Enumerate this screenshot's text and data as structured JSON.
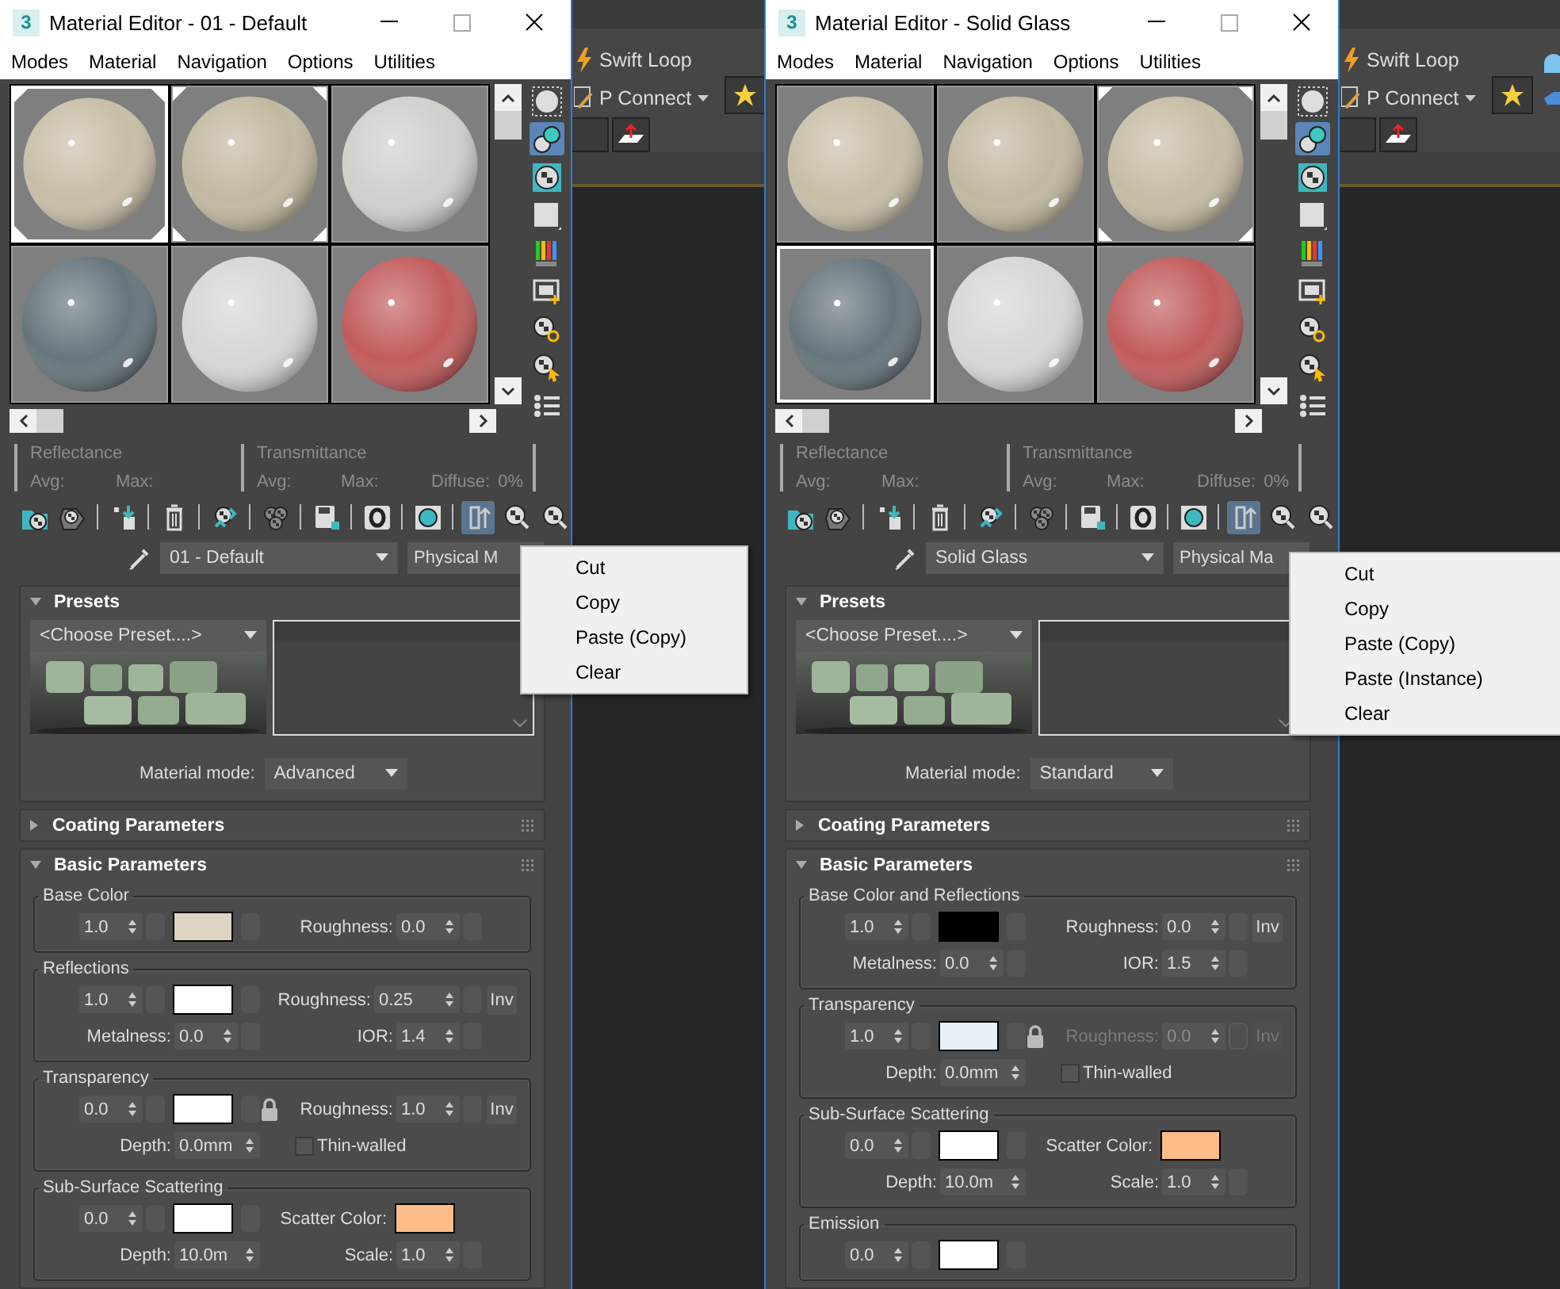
{
  "backdrop": {
    "ribbons": [
      {
        "tools": [
          "Swift Loop",
          "P Connect"
        ]
      },
      {
        "tools": [
          "Swift Loop",
          "P Connect"
        ]
      }
    ]
  },
  "windows": [
    {
      "title": "Material Editor - 01 - Default",
      "app_icon": "3",
      "menus": [
        "Modes",
        "Material",
        "Navigation",
        "Options",
        "Utilities"
      ],
      "slots": [
        {
          "color": "#c8bea6",
          "selected": true,
          "hot": true
        },
        {
          "color": "#c2b89f",
          "selected": false,
          "hot": true
        },
        {
          "color": "#cfcfcc",
          "selected": false,
          "hot": false
        },
        {
          "color": "#66757c",
          "selected": false,
          "hot": false
        },
        {
          "color": "#d6d6d6",
          "selected": false,
          "hot": false
        },
        {
          "color": "#c25b5b",
          "selected": false,
          "hot": false
        }
      ],
      "side_tools": [
        {
          "selected": false
        },
        {
          "selected": true
        },
        {
          "selected": false
        },
        {
          "selected": false
        },
        {
          "selected": false
        },
        {
          "selected": false
        },
        {
          "selected": false
        },
        {
          "selected": false
        },
        {
          "selected": false
        }
      ],
      "reflectance": {
        "title": "Reflectance",
        "avg": "Avg:",
        "max": "Max:"
      },
      "transmittance": {
        "title": "Transmittance",
        "avg": "Avg:",
        "max": "Max:",
        "diffuse": "Diffuse:",
        "diffuse_value": "0%"
      },
      "toolbar": [
        {
          "selected": false
        },
        {
          "selected": false
        },
        {
          "selected": false
        },
        {
          "selected": false
        },
        {
          "selected": false
        },
        {
          "selected": false
        },
        {
          "selected": false
        },
        {
          "selected": false
        },
        {
          "selected": false
        },
        {
          "selected": true
        },
        {
          "selected": false
        },
        {
          "selected": false
        }
      ],
      "material_name": "01 - Default",
      "material_type": "Physical M",
      "rollouts": [
        {
          "kind": "presets",
          "title": "Presets",
          "expanded": true,
          "preset": "<Choose Preset....>",
          "mode_label": "Material mode:",
          "mode": "Advanced"
        },
        {
          "kind": "params",
          "title": "Coating Parameters",
          "expanded": false
        },
        {
          "kind": "params",
          "title": "Basic Parameters",
          "expanded": true,
          "groups": [
            {
              "title": "Base Color",
              "rows": [
                {
                  "left": [
                    {
                      "kind": "spinner",
                      "value": "1.0",
                      "disabled": false
                    },
                    {
                      "kind": "map",
                      "disabled": false
                    },
                    {
                      "kind": "swatch",
                      "color": "#ddd4c2"
                    },
                    {
                      "kind": "map",
                      "disabled": false
                    }
                  ],
                  "right": [
                    {
                      "kind": "spinner",
                      "label": "Roughness:",
                      "value": "0.0",
                      "disabled": false
                    },
                    {
                      "kind": "map",
                      "disabled": false
                    }
                  ]
                }
              ]
            },
            {
              "title": "Reflections",
              "rows": [
                {
                  "left": [
                    {
                      "kind": "spinner",
                      "value": "1.0",
                      "disabled": false
                    },
                    {
                      "kind": "map",
                      "disabled": false
                    },
                    {
                      "kind": "swatch",
                      "color": "#ffffff"
                    },
                    {
                      "kind": "map",
                      "disabled": false
                    }
                  ],
                  "right": [
                    {
                      "kind": "spinner",
                      "label": "Roughness:",
                      "value": "0.25",
                      "disabled": false
                    },
                    {
                      "kind": "map",
                      "disabled": false
                    },
                    {
                      "kind": "inv",
                      "label": "Inv",
                      "disabled": false
                    }
                  ]
                },
                {
                  "left": [
                    {
                      "kind": "spinner",
                      "label": "Metalness:",
                      "value": "0.0",
                      "disabled": false
                    },
                    {
                      "kind": "map",
                      "disabled": false
                    }
                  ],
                  "right": [
                    {
                      "kind": "spinner",
                      "label": "IOR:",
                      "value": "1.4",
                      "disabled": false
                    },
                    {
                      "kind": "map",
                      "disabled": false
                    }
                  ]
                }
              ]
            },
            {
              "title": "Transparency",
              "rows": [
                {
                  "left": [
                    {
                      "kind": "spinner",
                      "value": "0.0",
                      "disabled": false
                    },
                    {
                      "kind": "map",
                      "disabled": false
                    },
                    {
                      "kind": "swatch",
                      "color": "#ffffff"
                    },
                    {
                      "kind": "map",
                      "disabled": false
                    }
                  ],
                  "right": [
                    {
                      "kind": "lock"
                    },
                    {
                      "kind": "spinner",
                      "label": "Roughness:",
                      "value": "1.0",
                      "disabled": false
                    },
                    {
                      "kind": "map",
                      "disabled": false
                    },
                    {
                      "kind": "inv",
                      "label": "Inv",
                      "disabled": false
                    }
                  ]
                },
                {
                  "left": [
                    {
                      "kind": "spinner",
                      "label": "Depth:",
                      "value": "0.0mm",
                      "disabled": false
                    }
                  ],
                  "right": [
                    {
                      "kind": "checkbox",
                      "label": "Thin-walled",
                      "checked": false
                    }
                  ]
                }
              ]
            },
            {
              "title": "Sub-Surface Scattering",
              "rows": [
                {
                  "left": [
                    {
                      "kind": "spinner",
                      "value": "0.0",
                      "disabled": false
                    },
                    {
                      "kind": "map",
                      "disabled": false
                    },
                    {
                      "kind": "swatch",
                      "color": "#ffffff"
                    },
                    {
                      "kind": "map",
                      "disabled": false
                    }
                  ],
                  "right": [
                    {
                      "kind": "swatch",
                      "label": "Scatter Color:",
                      "color": "#ffbb88"
                    }
                  ]
                },
                {
                  "left": [
                    {
                      "kind": "spinner",
                      "label": "Depth:",
                      "value": "10.0m",
                      "disabled": false
                    }
                  ],
                  "right": [
                    {
                      "kind": "spinner",
                      "label": "Scale:",
                      "value": "1.0",
                      "disabled": false
                    },
                    {
                      "kind": "map",
                      "disabled": false
                    }
                  ]
                }
              ]
            }
          ]
        }
      ],
      "context_menu": [
        "Cut",
        "Copy",
        "Paste (Copy)",
        "Clear"
      ]
    },
    {
      "title": "Material Editor - Solid Glass",
      "app_icon": "3",
      "menus": [
        "Modes",
        "Material",
        "Navigation",
        "Options",
        "Utilities"
      ],
      "slots": [
        {
          "color": "#c8bea6",
          "selected": false,
          "hot": false
        },
        {
          "color": "#c2b89f",
          "selected": false,
          "hot": false
        },
        {
          "color": "#c6bca3",
          "selected": false,
          "hot": true
        },
        {
          "color": "#66757c",
          "selected": true,
          "hot": false
        },
        {
          "color": "#d6d6d6",
          "selected": false,
          "hot": false
        },
        {
          "color": "#c25b5b",
          "selected": false,
          "hot": false
        }
      ],
      "side_tools": [
        {
          "selected": false
        },
        {
          "selected": true
        },
        {
          "selected": false
        },
        {
          "selected": false
        },
        {
          "selected": false
        },
        {
          "selected": false
        },
        {
          "selected": false
        },
        {
          "selected": false
        },
        {
          "selected": false
        }
      ],
      "reflectance": {
        "title": "Reflectance",
        "avg": "Avg:",
        "max": "Max:"
      },
      "transmittance": {
        "title": "Transmittance",
        "avg": "Avg:",
        "max": "Max:",
        "diffuse": "Diffuse:",
        "diffuse_value": "0%"
      },
      "toolbar": [
        {
          "selected": false
        },
        {
          "selected": false
        },
        {
          "selected": false
        },
        {
          "selected": false
        },
        {
          "selected": false
        },
        {
          "selected": false
        },
        {
          "selected": false
        },
        {
          "selected": false
        },
        {
          "selected": false
        },
        {
          "selected": true
        },
        {
          "selected": false
        },
        {
          "selected": false
        }
      ],
      "material_name": "Solid Glass",
      "material_type": "Physical Ma",
      "rollouts": [
        {
          "kind": "presets",
          "title": "Presets",
          "expanded": true,
          "preset": "<Choose Preset....>",
          "mode_label": "Material mode:",
          "mode": "Standard"
        },
        {
          "kind": "params",
          "title": "Coating Parameters",
          "expanded": false
        },
        {
          "kind": "params",
          "title": "Basic Parameters",
          "expanded": true,
          "groups": [
            {
              "title": "Base Color and Reflections",
              "rows": [
                {
                  "left": [
                    {
                      "kind": "spinner",
                      "value": "1.0",
                      "disabled": false
                    },
                    {
                      "kind": "map",
                      "disabled": false
                    },
                    {
                      "kind": "swatch",
                      "color": "#000000"
                    },
                    {
                      "kind": "map",
                      "disabled": false
                    }
                  ],
                  "right": [
                    {
                      "kind": "spinner",
                      "label": "Roughness:",
                      "value": "0.0",
                      "disabled": false
                    },
                    {
                      "kind": "map",
                      "disabled": false
                    },
                    {
                      "kind": "inv",
                      "label": "Inv",
                      "disabled": false
                    }
                  ]
                },
                {
                  "left": [
                    {
                      "kind": "spinner",
                      "label": "Metalness:",
                      "value": "0.0",
                      "disabled": false
                    },
                    {
                      "kind": "map",
                      "disabled": false
                    }
                  ],
                  "right": [
                    {
                      "kind": "spinner",
                      "label": "IOR:",
                      "value": "1.5",
                      "disabled": false
                    },
                    {
                      "kind": "map",
                      "disabled": false
                    }
                  ]
                }
              ]
            },
            {
              "title": "Transparency",
              "rows": [
                {
                  "left": [
                    {
                      "kind": "spinner",
                      "value": "1.0",
                      "disabled": false
                    },
                    {
                      "kind": "map",
                      "disabled": false
                    },
                    {
                      "kind": "swatch",
                      "color": "#e8f0f6"
                    },
                    {
                      "kind": "map",
                      "disabled": false
                    }
                  ],
                  "right": [
                    {
                      "kind": "lock"
                    },
                    {
                      "kind": "spinner",
                      "label": "Roughness:",
                      "value": "0.0",
                      "disabled": true
                    },
                    {
                      "kind": "map",
                      "disabled": true
                    },
                    {
                      "kind": "inv",
                      "label": "Inv",
                      "disabled": true
                    }
                  ]
                },
                {
                  "left": [
                    {
                      "kind": "spinner",
                      "label": "Depth:",
                      "value": "0.0mm",
                      "disabled": false
                    }
                  ],
                  "right": [
                    {
                      "kind": "checkbox",
                      "label": "Thin-walled",
                      "checked": false
                    }
                  ]
                }
              ]
            },
            {
              "title": "Sub-Surface Scattering",
              "rows": [
                {
                  "left": [
                    {
                      "kind": "spinner",
                      "value": "0.0",
                      "disabled": false
                    },
                    {
                      "kind": "map",
                      "disabled": false
                    },
                    {
                      "kind": "swatch",
                      "color": "#ffffff"
                    },
                    {
                      "kind": "map",
                      "disabled": false
                    }
                  ],
                  "right": [
                    {
                      "kind": "swatch",
                      "label": "Scatter Color:",
                      "color": "#ffbb88"
                    }
                  ]
                },
                {
                  "left": [
                    {
                      "kind": "spinner",
                      "label": "Depth:",
                      "value": "10.0m",
                      "disabled": false
                    }
                  ],
                  "right": [
                    {
                      "kind": "spinner",
                      "label": "Scale:",
                      "value": "1.0",
                      "disabled": false
                    },
                    {
                      "kind": "map",
                      "disabled": false
                    }
                  ]
                }
              ]
            },
            {
              "title": "Emission",
              "rows": [
                {
                  "left": [
                    {
                      "kind": "spinner",
                      "value": "0.0",
                      "disabled": false
                    },
                    {
                      "kind": "map",
                      "disabled": false
                    },
                    {
                      "kind": "swatch",
                      "color": "#ffffff"
                    },
                    {
                      "kind": "map",
                      "disabled": false
                    }
                  ],
                  "right": []
                }
              ]
            }
          ]
        }
      ],
      "context_menu": [
        "Cut",
        "Copy",
        "Paste (Copy)",
        "Paste (Instance)",
        "Clear"
      ]
    }
  ]
}
